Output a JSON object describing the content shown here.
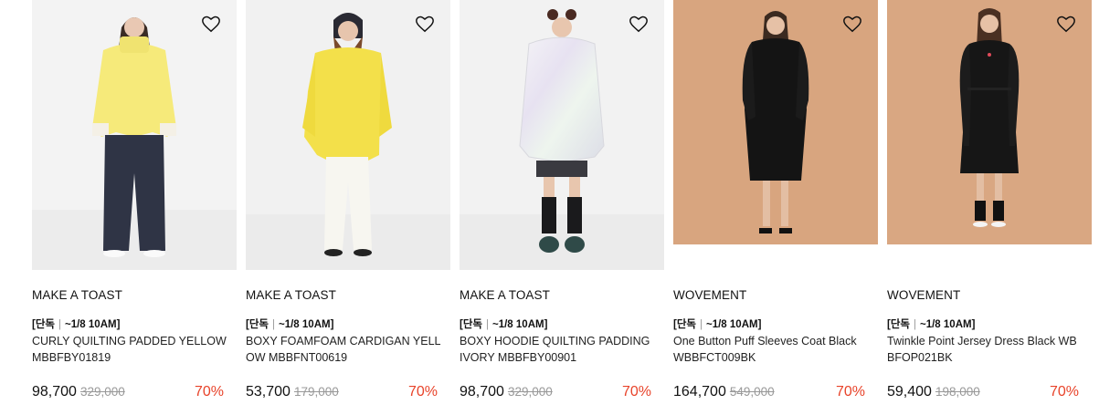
{
  "colors": {
    "discount": "#e8432a",
    "original_price": "#999999",
    "bg_studio": "#f2f2f2",
    "bg_tan": "#d9a580"
  },
  "products": [
    {
      "brand": "MAKE A TOAST",
      "promo_tag": "[단독",
      "promo_date": "~1/8 10AM]",
      "name": "CURLY QUILTING PADDED YELLOW MBBFBY01819",
      "price": "98,700",
      "original_price": "329,000",
      "discount": "70%",
      "icon": "heart-icon"
    },
    {
      "brand": "MAKE A TOAST",
      "promo_tag": "[단독",
      "promo_date": "~1/8 10AM]",
      "name": "BOXY FOAMFOAM CARDIGAN YELLOW MBBFNT00619",
      "price": "53,700",
      "original_price": "179,000",
      "discount": "70%",
      "icon": "heart-icon"
    },
    {
      "brand": "MAKE A TOAST",
      "promo_tag": "[단독",
      "promo_date": "~1/8 10AM]",
      "name": "BOXY HOODIE QUILTING PADDING IVORY MBBFBY00901",
      "price": "98,700",
      "original_price": "329,000",
      "discount": "70%",
      "icon": "heart-icon"
    },
    {
      "brand": "WOVEMENT",
      "promo_tag": "[단독",
      "promo_date": "~1/8 10AM]",
      "name": "One Button Puff Sleeves Coat Black WBBFCT009BK",
      "price": "164,700",
      "original_price": "549,000",
      "discount": "70%",
      "icon": "heart-icon"
    },
    {
      "brand": "WOVEMENT",
      "promo_tag": "[단독",
      "promo_date": "~1/8 10AM]",
      "name": "Twinkle Point Jersey Dress Black WBBFOP021BK",
      "price": "59,400",
      "original_price": "198,000",
      "discount": "70%",
      "icon": "heart-icon"
    }
  ]
}
